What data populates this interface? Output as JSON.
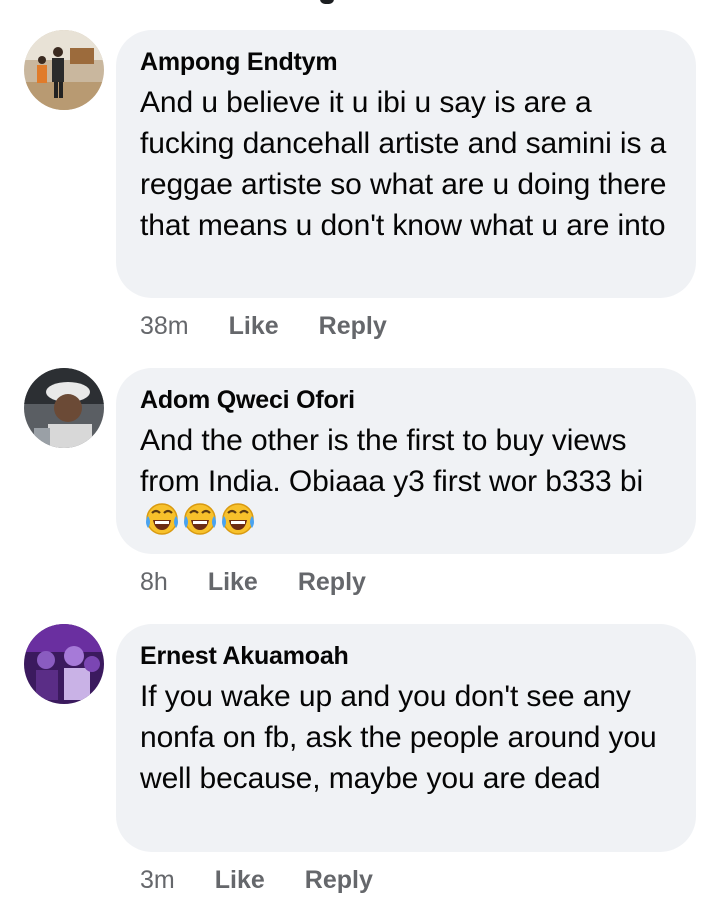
{
  "comments": [
    {
      "author": "Ampong Endtym",
      "text": "And u believe it u ibi u say is are a fucking dancehall artiste and samini is a reggae artiste so what are u doing there  that means u don't know what u are into",
      "time": "38m",
      "like_label": "Like",
      "reply_label": "Reply"
    },
    {
      "author": "Adom Qweci Ofori",
      "text": "And the other is the first to buy views from India. Obiaaa y3 first wor b333 bi",
      "emojis": [
        "face-with-tears-of-joy",
        "face-with-tears-of-joy",
        "face-with-tears-of-joy"
      ],
      "time": "8h",
      "like_label": "Like",
      "reply_label": "Reply"
    },
    {
      "author": "Ernest Akuamoah",
      "text": "If you wake up and you don't see any nonfa on fb, ask the people around you well because, maybe you are dead",
      "time": "3m",
      "like_label": "Like",
      "reply_label": "Reply"
    }
  ],
  "colors": {
    "bubble": "#f0f2f5",
    "text": "#050505",
    "meta": "#65676b"
  }
}
